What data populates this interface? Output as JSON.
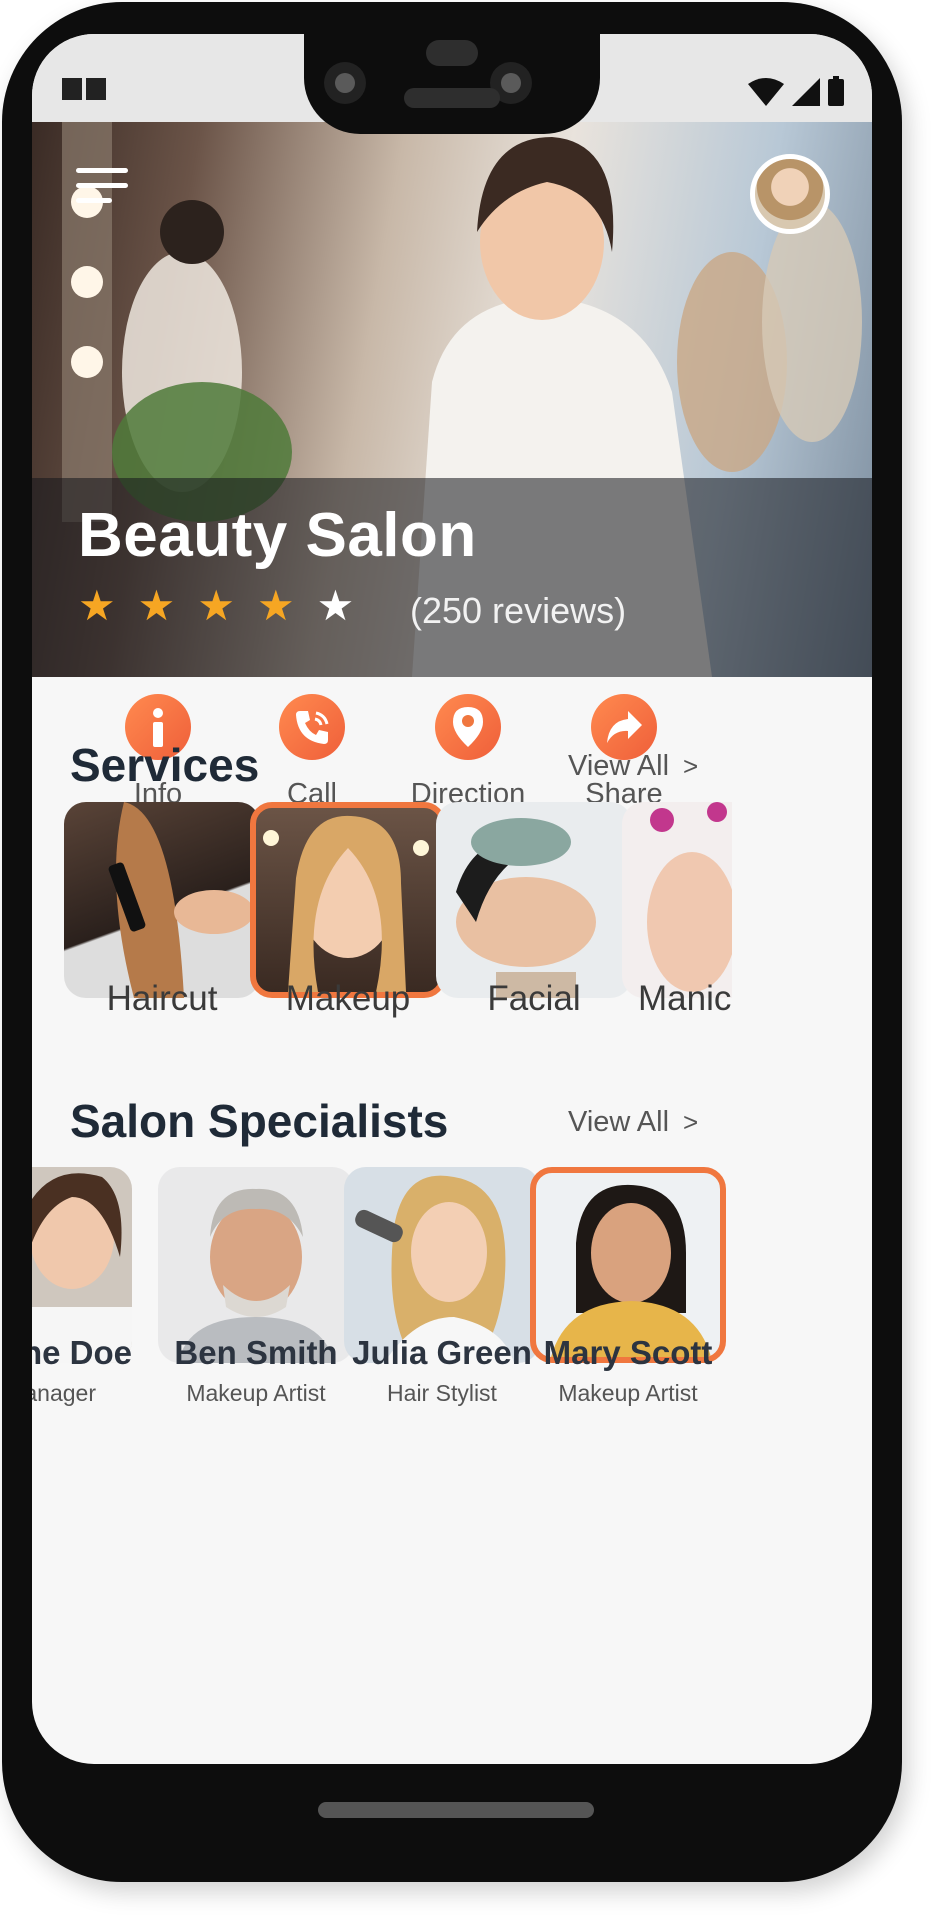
{
  "hero": {
    "title": "Beauty Salon",
    "rating": 4,
    "rating_max": 5,
    "reviews": "(250 reviews)"
  },
  "actions": [
    {
      "label": "Info",
      "icon": "info-icon"
    },
    {
      "label": "Call",
      "icon": "phone-icon"
    },
    {
      "label": "Direction",
      "icon": "location-pin-icon"
    },
    {
      "label": "Share",
      "icon": "share-arrow-icon"
    }
  ],
  "services": {
    "title": "Services",
    "view_all": "View All",
    "items": [
      {
        "label": "Haircut"
      },
      {
        "label": "Makeup",
        "selected": true
      },
      {
        "label": "Facial"
      },
      {
        "label": "Manic"
      }
    ]
  },
  "specialists": {
    "title": "Salon Specialists",
    "view_all": "View All",
    "items": [
      {
        "name": "ne Doe",
        "role": "anager"
      },
      {
        "name": "Ben Smith",
        "role": "Makeup Artist"
      },
      {
        "name": "Julia Green",
        "role": "Hair Stylist"
      },
      {
        "name": "Mary Scott",
        "role": "Makeup Artist",
        "selected": true
      }
    ]
  },
  "colors": {
    "accent": "#f0773f",
    "star_filled": "#f6a623",
    "star_empty": "#ffffff",
    "text_dark": "#1f2a37"
  }
}
